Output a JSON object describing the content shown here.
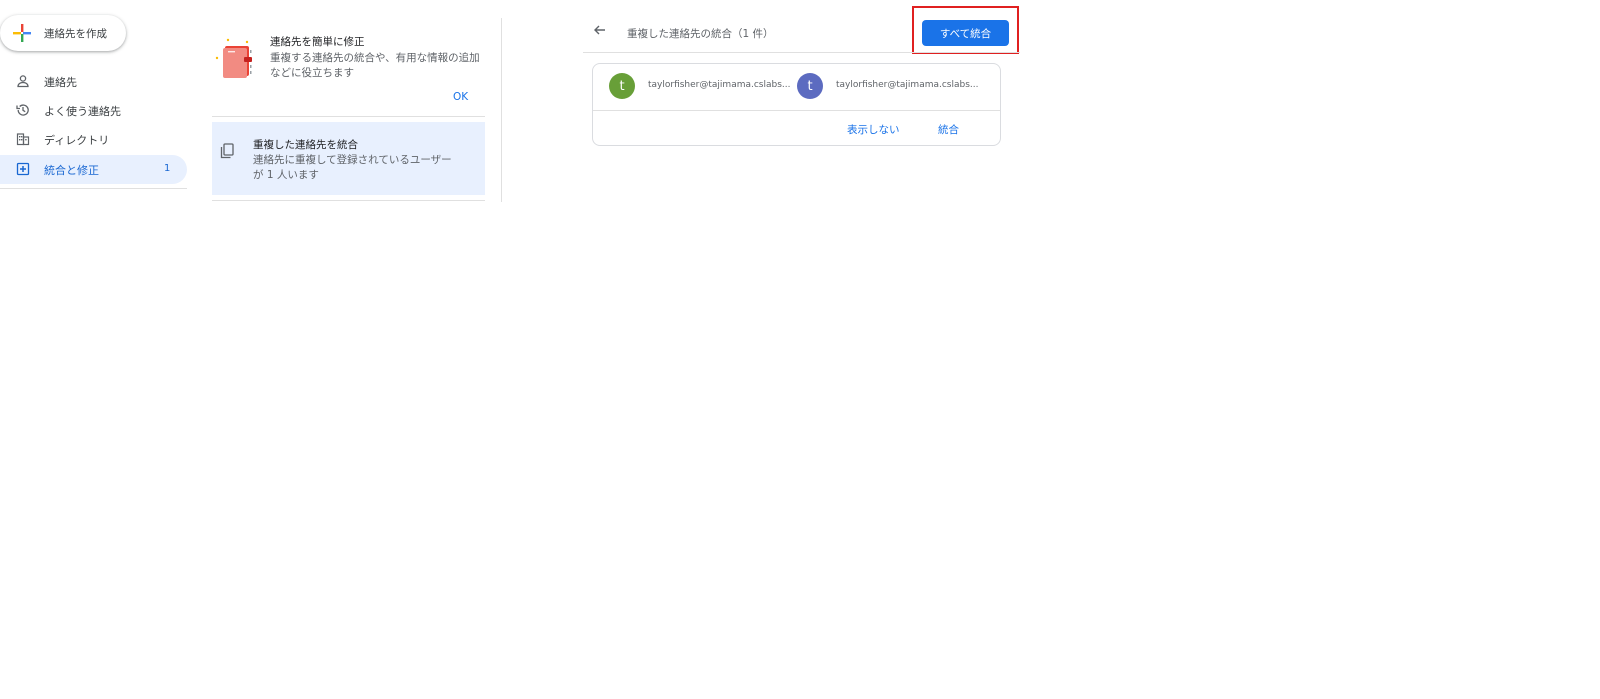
{
  "sidebar": {
    "create_label": "連絡先を作成",
    "items": [
      {
        "label": "連絡先",
        "icon": "person-icon"
      },
      {
        "label": "よく使う連絡先",
        "icon": "history-icon"
      },
      {
        "label": "ディレクトリ",
        "icon": "domain-icon"
      },
      {
        "label": "統合と修正",
        "icon": "merge-fix-icon",
        "count": "1",
        "active": true
      }
    ]
  },
  "middle": {
    "tip": {
      "title": "連絡先を簡単に修正",
      "description": "重複する連絡先の統合や、有用な情報の追加などに役立ちます",
      "ok_label": "OK"
    },
    "merge_card": {
      "title": "重複した連絡先を統合",
      "description": "連絡先に重複して登録されているユーザーが 1 人います"
    }
  },
  "right": {
    "title": "重複した連絡先の統合（1 件）",
    "merge_all_label": "すべて統合",
    "duplicate": {
      "contact1": {
        "initial": "t",
        "email": "taylorfisher@tajimama.cslabs..."
      },
      "contact2": {
        "initial": "t",
        "email": "taylorfisher@tajimama.cslabs..."
      },
      "dismiss_label": "表示しない",
      "merge_label": "統合"
    }
  },
  "colors": {
    "accent": "#1a73e8",
    "active_bg": "#e8f0fe",
    "avatar1": "#689f38",
    "avatar2": "#5c6bc0",
    "highlight": "#e02020"
  }
}
